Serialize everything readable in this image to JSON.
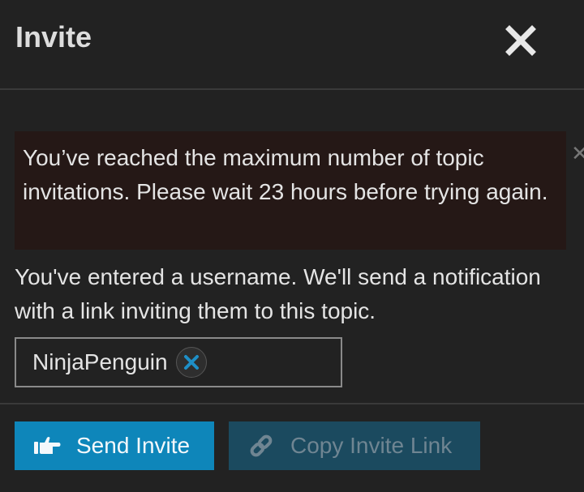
{
  "modal": {
    "title": "Invite"
  },
  "alert": {
    "message": "You’ve reached the maximum number of topic invitations. Please wait 23 hours before trying again."
  },
  "help": {
    "text": "You've entered a username. We'll send a notification with a link inviting them to this topic."
  },
  "recipients": {
    "selected": [
      "NinjaPenguin"
    ]
  },
  "buttons": {
    "send_label": "Send Invite",
    "copy_label": "Copy Invite Link"
  },
  "icons": {
    "close": "close-icon",
    "alert_dismiss": "close-icon",
    "chip_remove": "x-circle-icon",
    "send": "hand-point-right-icon",
    "copy": "link-icon"
  },
  "colors": {
    "background": "#222222",
    "alert_background": "#251816",
    "primary_button": "#0e86ba",
    "secondary_button": "#1b4a5f",
    "chip_remove_x": "#1e8fc7"
  }
}
